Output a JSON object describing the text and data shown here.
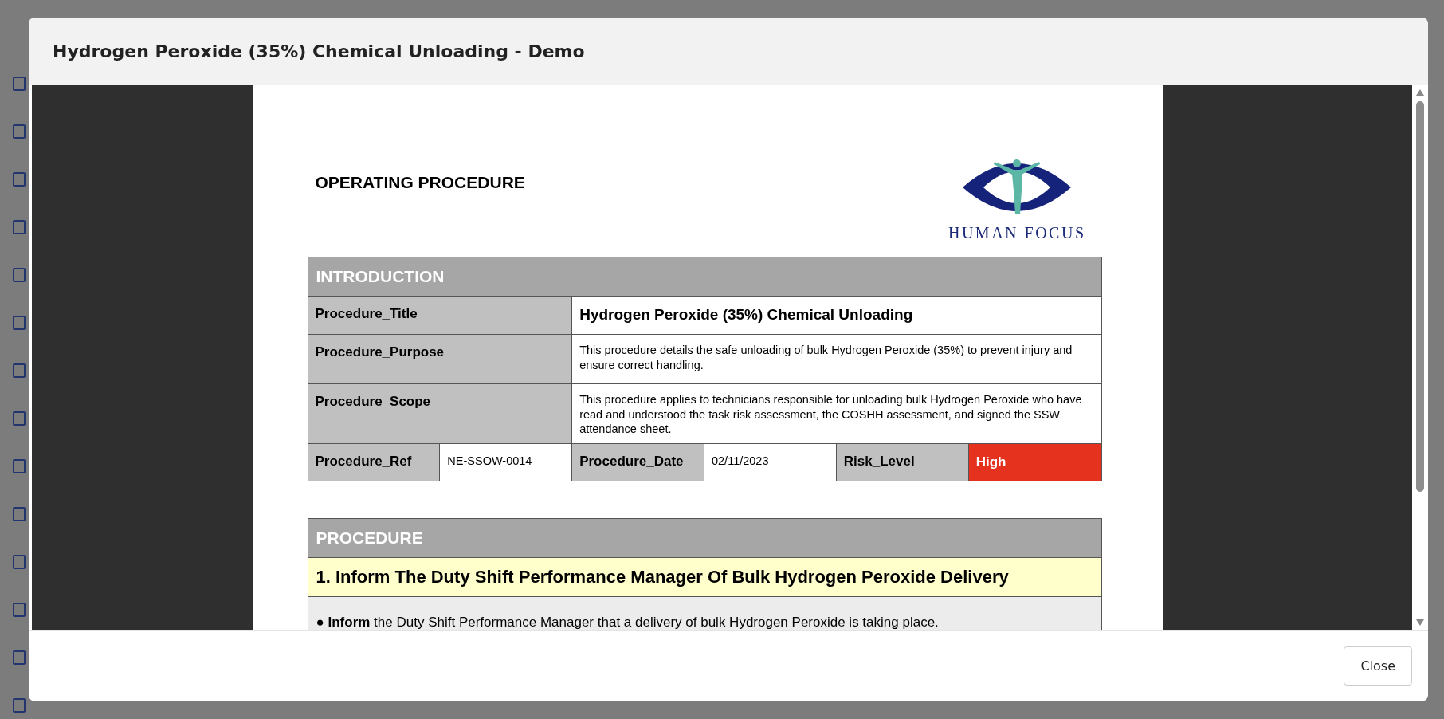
{
  "dialog": {
    "title": "Hydrogen Peroxide (35%) Chemical Unloading - Demo",
    "document": {
      "heading": "OPERATING PROCEDURE",
      "logo_text": "HUMAN FOCUS",
      "introduction": {
        "title": "INTRODUCTION",
        "rows": [
          {
            "label": "Procedure_Title",
            "value": "Hydrogen Peroxide (35%) Chemical Unloading",
            "kind": "title"
          },
          {
            "label": "Procedure_Purpose",
            "value": "This procedure details the safe unloading of bulk Hydrogen Peroxide (35%) to prevent injury and ensure correct handling.",
            "kind": "text"
          },
          {
            "label": "Procedure_Scope",
            "value": "This procedure applies to technicians responsible for unloading bulk Hydrogen Peroxide who have read and understood the task risk assessment, the COSHH assessment, and signed the SSW attendance sheet.",
            "kind": "text"
          }
        ],
        "fields": [
          {
            "label": "Procedure_Ref",
            "value": "NE-SSOW-0014"
          },
          {
            "label": "Procedure_Date",
            "value": "02/11/2023"
          },
          {
            "label": "Risk_Level",
            "value": "High",
            "color": "#e5321f"
          }
        ]
      },
      "procedure": {
        "title": "PROCEDURE",
        "steps": [
          {
            "title": "1. Inform The Duty Shift Performance Manager Of Bulk Hydrogen Peroxide Delivery",
            "items": [
              "● **Inform** the Duty Shift Performance Manager that a delivery of bulk Hydrogen Peroxide is taking place."
            ]
          }
        ]
      }
    },
    "buttons": [
      "Close"
    ]
  }
}
